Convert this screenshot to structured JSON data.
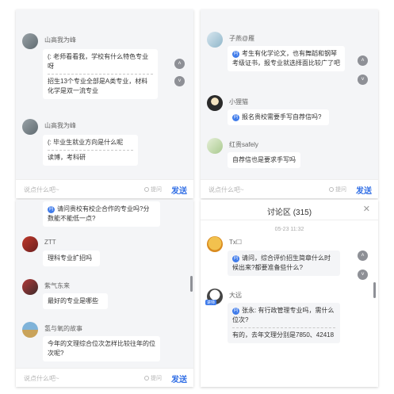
{
  "common": {
    "input_placeholder": "说点什么吧~",
    "ask_label": "提问",
    "send_label": "发送",
    "q_tag": "问"
  },
  "panel1": {
    "messages": [
      {
        "name": "山高我为峰",
        "text1": "(: 老师看看我，学校有什么特色专业呀",
        "text2": "招生13个专业全部是A类专业，材料化学是双一流专业"
      },
      {
        "name": "山高我为峰",
        "text1": "(: 毕业生就业方向是什么呢",
        "text2": "读博，考科研"
      }
    ]
  },
  "panel2": {
    "messages": [
      {
        "name": "子燕@雁",
        "text": "考生有化学论文，也有舞蹈和钢琴考级证书，报专业就选择面比较广了吧"
      },
      {
        "name": "小狸猫",
        "text": "报名贵校需要手写自荐信吗?"
      },
      {
        "name": "红贵safely",
        "text": "自荐信也是要求手写吗"
      }
    ]
  },
  "panel3": {
    "messages": [
      {
        "name": "",
        "text": "请问贵校有校企合作的专业吗?分数能不能低一点?"
      },
      {
        "name": "ZTT",
        "text": "理科专业扩招吗"
      },
      {
        "name": "紫气东来",
        "text": "最好的专业是哪些"
      },
      {
        "name": "氢与氧的故事",
        "text": "今年的文理综合位次怎样比较往年的位次呢?"
      }
    ]
  },
  "panel4": {
    "title": "讨论区 (315)",
    "time": "05-23 11:32",
    "messages": [
      {
        "name": "Tx☐",
        "text": "请问，综合评价招生简章什么时候出来?都要准备些什么?"
      },
      {
        "name": "大远",
        "badge": "讲师",
        "text1": "张永: 有行政管理专业吗，需什么位次?",
        "text2": "有的，去年文理分别是7850、42418"
      }
    ]
  },
  "colors": {
    "accent": "#2f6de5",
    "panel_bg": "#f4f5f7"
  }
}
